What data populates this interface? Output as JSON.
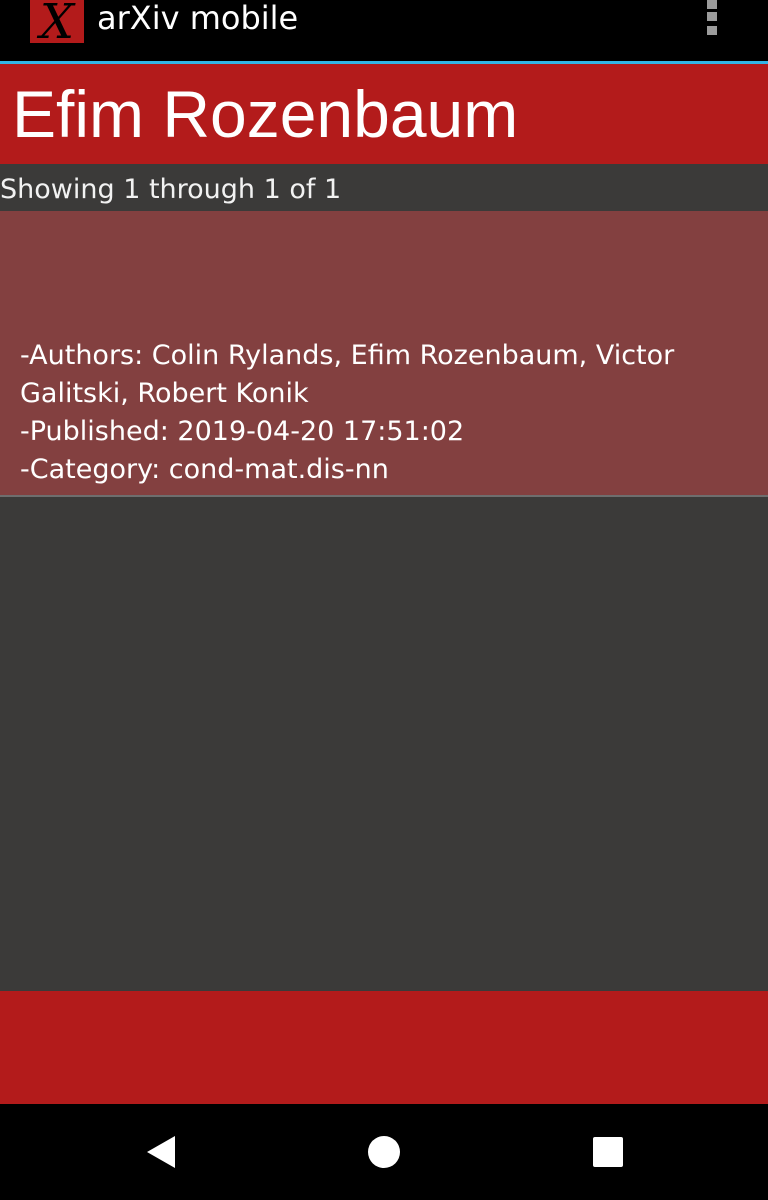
{
  "app_bar": {
    "logo_letter": "X",
    "title": "arXiv mobile"
  },
  "header": {
    "title": "Efim Rozenbaum"
  },
  "results": {
    "count_text": "Showing 1 through 1 of 1",
    "items": [
      {
        "authors_line1": "-Authors: Colin Rylands, Efim Rozenbaum, Victor",
        "authors_line2": "Galitski, Robert Konik",
        "published": "-Published: 2019-04-20 17:51:02",
        "category": "-Category: cond-mat.dis-nn"
      }
    ]
  },
  "icons": {
    "overflow": "overflow-menu-icon",
    "back": "back-triangle-icon",
    "home": "home-circle-icon",
    "recents": "recents-square-icon"
  },
  "colors": {
    "brand_red": "#b31b1b",
    "card": "#834040",
    "background": "#3b3a39",
    "accent_line": "#33b5e5"
  }
}
